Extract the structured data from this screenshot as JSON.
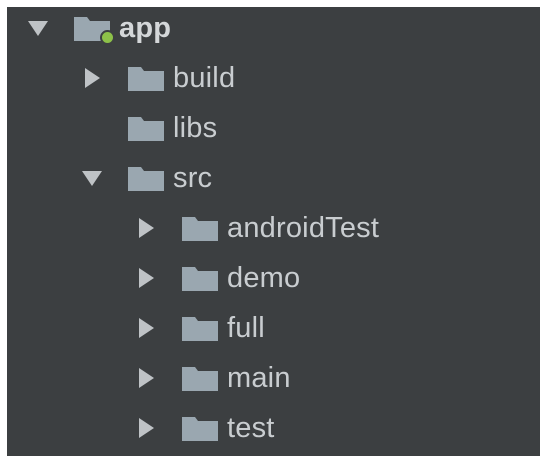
{
  "colors": {
    "background": "#3c3f41",
    "text": "#c9cdd0",
    "folder": "#9aa7b0",
    "module_dot": "#8dc149",
    "arrow": "#bfc3c6"
  },
  "tree": [
    {
      "label": "app",
      "expanded": true,
      "has_children": true,
      "module": true,
      "icon": "module-folder-icon"
    },
    {
      "label": "build",
      "expanded": false,
      "has_children": true,
      "icon": "folder-icon"
    },
    {
      "label": "libs",
      "expanded": false,
      "has_children": false,
      "icon": "folder-icon"
    },
    {
      "label": "src",
      "expanded": true,
      "has_children": true,
      "icon": "folder-icon"
    },
    {
      "label": "androidTest",
      "expanded": false,
      "has_children": true,
      "icon": "folder-icon"
    },
    {
      "label": "demo",
      "expanded": false,
      "has_children": true,
      "icon": "folder-icon"
    },
    {
      "label": "full",
      "expanded": false,
      "has_children": true,
      "icon": "folder-icon"
    },
    {
      "label": "main",
      "expanded": false,
      "has_children": true,
      "icon": "folder-icon"
    },
    {
      "label": "test",
      "expanded": false,
      "has_children": true,
      "icon": "folder-icon"
    }
  ]
}
